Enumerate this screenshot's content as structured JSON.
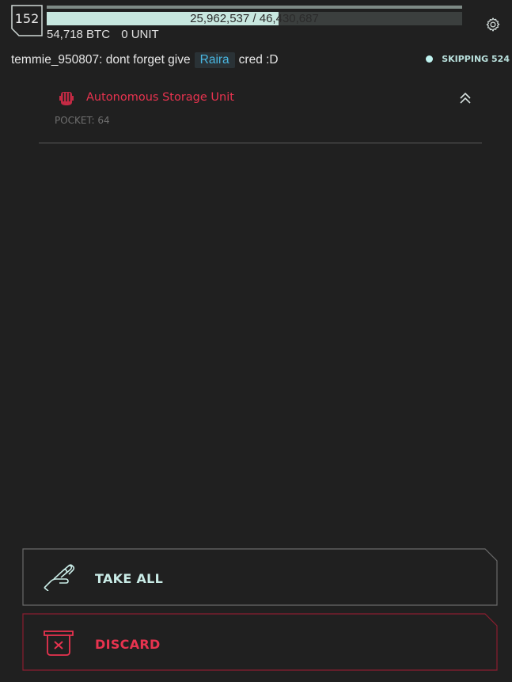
{
  "player": {
    "level": "152",
    "xp_text": "25,962,537 / 46,430,687",
    "xp_fraction": 0.559,
    "btc": "54,718 BTC",
    "unit": "0 UNIT"
  },
  "chat": {
    "user_message": "temmie_950807: dont forget give",
    "tag": "Raira",
    "suffix": "cred :D"
  },
  "status": {
    "label": "SKIPPING 524"
  },
  "item": {
    "name": "Autonomous Storage Unit",
    "pocket": "POCKET: 64"
  },
  "actions": {
    "take_all": "TAKE ALL",
    "discard": "DISCARD"
  },
  "colors": {
    "accent_red": "#e8334f",
    "accent_cyan": "#c7e7df",
    "tag_blue": "#49b7e2",
    "background": "#202020"
  },
  "icons": {
    "settings": "gear-icon",
    "item": "storage-unit-icon",
    "collapse": "double-chevron-up-icon",
    "take_all": "hand-icon",
    "discard": "trash-icon"
  }
}
